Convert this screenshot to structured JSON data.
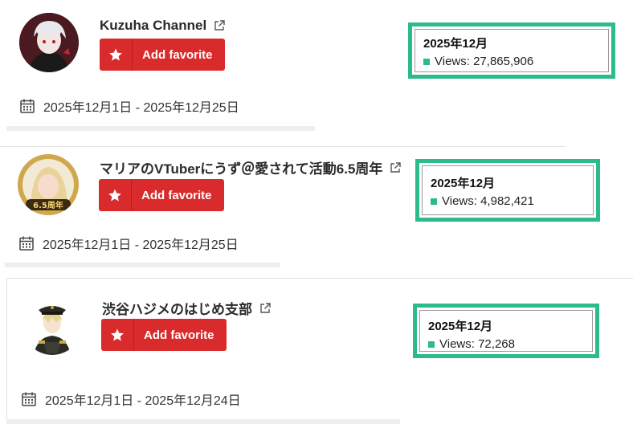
{
  "favorite_label": "Add favorite",
  "accent_color": "#2dba8d",
  "button_color": "#d92b2b",
  "channels": [
    {
      "name": "Kuzuha Channel",
      "date_range": "2025年12月1日 - 2025年12月25日",
      "stats_month": "2025年12月",
      "views_label": "Views:",
      "views_value": "27,865,906"
    },
    {
      "name": "マリアのVTuberにうず＠愛されて活動6.5周年",
      "date_range": "2025年12月1日 - 2025年12月25日",
      "stats_month": "2025年12月",
      "views_label": "Views:",
      "views_value": "4,982,421",
      "avatar_badge": "6.5周年"
    },
    {
      "name": "渋谷ハジメのはじめ支部",
      "date_range": "2025年12月1日 - 2025年12月24日",
      "stats_month": "2025年12月",
      "views_label": "Views:",
      "views_value": "72,268"
    }
  ]
}
